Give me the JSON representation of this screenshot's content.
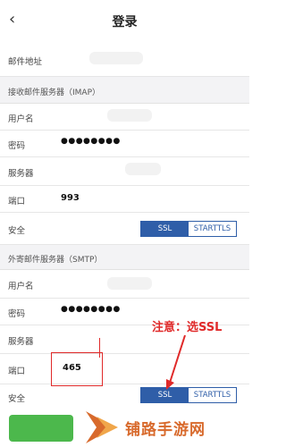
{
  "nav": {
    "back_icon": "chevron-left-icon",
    "title": "登录"
  },
  "account": {
    "email_label": "邮件地址"
  },
  "imap": {
    "section_title": "接收邮件服务器（IMAP）",
    "username_label": "用户名",
    "password_label": "密码",
    "password_mask": "●●●●●●●●",
    "server_label": "服务器",
    "port_label": "端口",
    "port_value": "993",
    "security_label": "安全",
    "security_options": [
      "SSL",
      "STARTTLS"
    ],
    "security_selected": "SSL"
  },
  "smtp": {
    "section_title": "外寄邮件服务器（SMTP）",
    "username_label": "用户名",
    "password_label": "密码",
    "password_mask": "●●●●●●●●",
    "server_label": "服务器",
    "port_label": "端口",
    "port_value": "465",
    "security_label": "安全",
    "security_options": [
      "SSL",
      "STARTTLS"
    ],
    "security_selected": "SSL"
  },
  "annotation": {
    "text": "注意：选SSL"
  },
  "watermark": {
    "text": "铺路手游网"
  },
  "colors": {
    "accent": "#2f5ea8",
    "annotation": "#e02a2a",
    "button": "#4cb84c",
    "watermark": "#d86a2c"
  }
}
